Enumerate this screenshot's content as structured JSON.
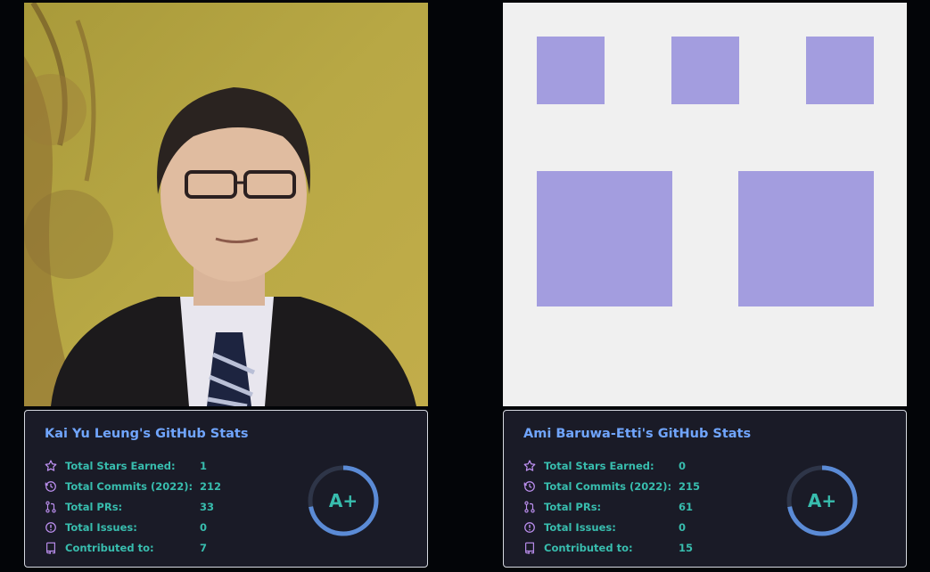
{
  "cards": [
    {
      "title": "Kai Yu Leung's GitHub Stats",
      "stats": [
        {
          "icon": "star-icon",
          "label": "Total Stars Earned:",
          "value": "1"
        },
        {
          "icon": "history-clock-icon",
          "label": "Total Commits (2022):",
          "value": "212"
        },
        {
          "icon": "pull-request-icon",
          "label": "Total PRs:",
          "value": "33"
        },
        {
          "icon": "issue-icon",
          "label": "Total Issues:",
          "value": "0"
        },
        {
          "icon": "repo-icon",
          "label": "Contributed to:",
          "value": "7"
        }
      ],
      "rank": "A+",
      "rank_progress": 0.72
    },
    {
      "title": "Ami Baruwa-Etti's GitHub Stats",
      "stats": [
        {
          "icon": "star-icon",
          "label": "Total Stars Earned:",
          "value": "0"
        },
        {
          "icon": "history-clock-icon",
          "label": "Total Commits (2022):",
          "value": "215"
        },
        {
          "icon": "pull-request-icon",
          "label": "Total PRs:",
          "value": "61"
        },
        {
          "icon": "issue-icon",
          "label": "Total Issues:",
          "value": "0"
        },
        {
          "icon": "repo-icon",
          "label": "Contributed to:",
          "value": "15"
        }
      ],
      "rank": "A+",
      "rank_progress": 0.72
    }
  ],
  "colors": {
    "background": "#030508",
    "card_bg": "#1a1b27",
    "title": "#70a5fd",
    "text": "#38bdae",
    "icon": "#bf91f3",
    "ring": "#5b8bd6",
    "ring_track": "#2e3548",
    "identicon_bg": "#f0f0f0",
    "identicon_fg": "#a39ddf"
  }
}
